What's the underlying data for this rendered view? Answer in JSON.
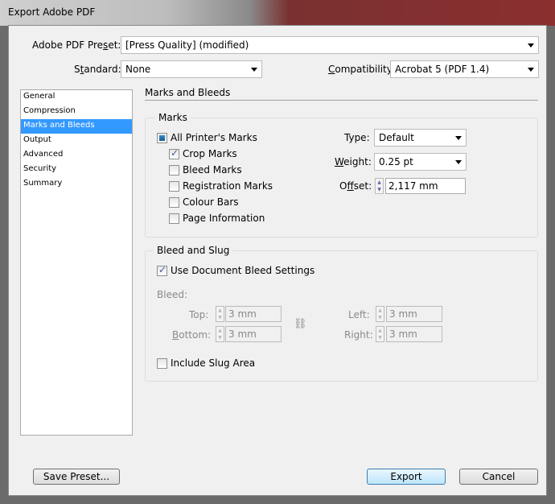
{
  "window": {
    "title": "Export Adobe PDF"
  },
  "preset": {
    "label": "Adobe PDF Preset:",
    "value": "[Press Quality] (modified)"
  },
  "standard": {
    "label": "Standard:",
    "value": "None"
  },
  "compatibility": {
    "label": "Compatibility:",
    "value": "Acrobat 5 (PDF 1.4)"
  },
  "sidebar": {
    "items": [
      {
        "label": "General"
      },
      {
        "label": "Compression"
      },
      {
        "label": "Marks and Bleeds",
        "active": true
      },
      {
        "label": "Output"
      },
      {
        "label": "Advanced"
      },
      {
        "label": "Security"
      },
      {
        "label": "Summary"
      }
    ]
  },
  "panel": {
    "title": "Marks and Bleeds"
  },
  "marks": {
    "group_label": "Marks",
    "all": {
      "label": "All Printer's Marks",
      "state": "mixed"
    },
    "items": [
      {
        "label": "Crop Marks",
        "checked": true
      },
      {
        "label": "Bleed Marks",
        "checked": false
      },
      {
        "label": "Registration Marks",
        "checked": false
      },
      {
        "label": "Colour Bars",
        "checked": false
      },
      {
        "label": "Page Information",
        "checked": false
      }
    ],
    "type": {
      "label": "Type:",
      "value": "Default"
    },
    "weight": {
      "label": "Weight:",
      "value": "0.25 pt"
    },
    "offset": {
      "label": "Offset:",
      "value": "2,117 mm"
    }
  },
  "bleed": {
    "group_label": "Bleed and Slug",
    "use_doc": {
      "label": "Use Document Bleed Settings",
      "checked": true
    },
    "bleed_label": "Bleed:",
    "top": {
      "label": "Top:",
      "value": "3 mm"
    },
    "bottom": {
      "label": "Bottom:",
      "value": "3 mm"
    },
    "left": {
      "label": "Left:",
      "value": "3 mm"
    },
    "right": {
      "label": "Right:",
      "value": "3 mm"
    },
    "slug": {
      "label": "Include Slug Area",
      "checked": false
    }
  },
  "buttons": {
    "save_preset": "Save Preset...",
    "export": "Export",
    "cancel": "Cancel"
  },
  "colors": {
    "selection": "#3399ff",
    "accent_button": "#3c7fb1"
  }
}
